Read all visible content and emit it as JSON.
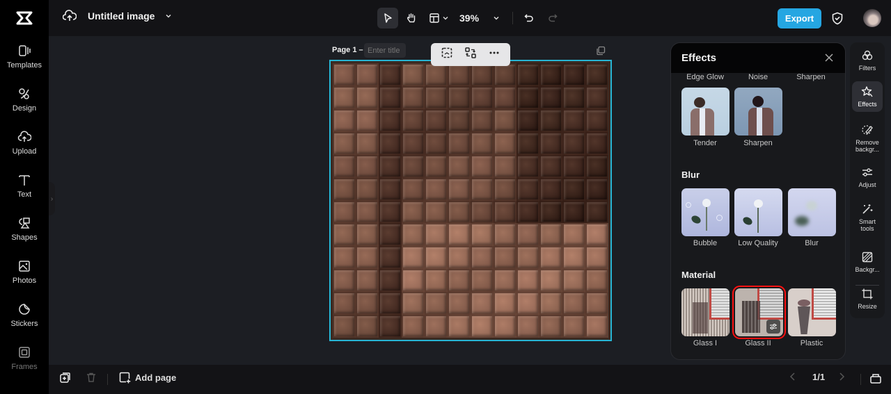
{
  "app": {
    "logo": "capcut-logo"
  },
  "header": {
    "doc_title": "Untitled image",
    "zoom_level": "39%",
    "export_label": "Export"
  },
  "leftnav": {
    "items": [
      {
        "label": "Templates",
        "icon": "templates-icon"
      },
      {
        "label": "Design",
        "icon": "design-icon"
      },
      {
        "label": "Upload",
        "icon": "upload-icon"
      },
      {
        "label": "Text",
        "icon": "text-icon"
      },
      {
        "label": "Shapes",
        "icon": "shapes-icon"
      },
      {
        "label": "Photos",
        "icon": "photos-icon"
      },
      {
        "label": "Stickers",
        "icon": "stickers-icon"
      },
      {
        "label": "Frames",
        "icon": "frames-icon"
      }
    ]
  },
  "canvas": {
    "page_label": "Page 1 –",
    "title_placeholder": "Enter title",
    "selection_color": "#27b5d4"
  },
  "effects_panel": {
    "title": "Effects",
    "top_row_labels": [
      "Edge Glow",
      "Noise",
      "Sharpen"
    ],
    "row1": [
      {
        "label": "Tender"
      },
      {
        "label": "Sharpen"
      }
    ],
    "sections": [
      {
        "title": "Blur",
        "items": [
          {
            "label": "Bubble"
          },
          {
            "label": "Low Quality"
          },
          {
            "label": "Blur"
          }
        ]
      },
      {
        "title": "Material",
        "items": [
          {
            "label": "Glass I"
          },
          {
            "label": "Glass II",
            "selected": true
          },
          {
            "label": "Plastic"
          }
        ]
      }
    ]
  },
  "rightrail": {
    "items": [
      {
        "label": "Filters"
      },
      {
        "label": "Effects",
        "active": true
      },
      {
        "label": "Remove backgr..."
      },
      {
        "label": "Adjust"
      },
      {
        "label": "Smart tools"
      },
      {
        "label": "Backgr..."
      },
      {
        "label": "Resize"
      }
    ]
  },
  "bottombar": {
    "add_page_label": "Add page",
    "page_counter": "1/1"
  },
  "colors": {
    "accent": "#25a6e2",
    "selection_highlight": "#ff1010"
  }
}
